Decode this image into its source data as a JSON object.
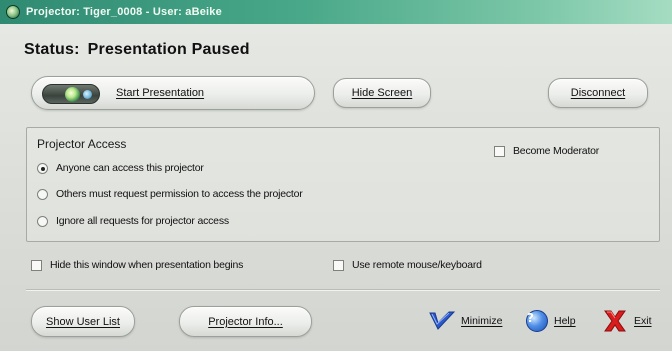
{
  "window": {
    "title": "Projector: Tiger_0008 - User: aBeike",
    "app_icon": "projector-app-icon"
  },
  "status": {
    "label": "Status:",
    "value": "Presentation Paused"
  },
  "top_buttons": {
    "start_presentation": "Start Presentation",
    "hide_screen": "Hide Screen",
    "disconnect": "Disconnect"
  },
  "access": {
    "legend": "Projector Access",
    "options": [
      {
        "label": "Anyone can access this projector",
        "checked": true
      },
      {
        "label": "Others must request permission to access the projector",
        "checked": false
      },
      {
        "label": "Ignore all requests for projector access",
        "checked": false
      }
    ],
    "become_moderator": {
      "label": "Become Moderator",
      "checked": false
    }
  },
  "options": {
    "hide_window": {
      "label": "Hide this window when presentation begins",
      "checked": false
    },
    "remote_input": {
      "label": "Use remote mouse/keyboard",
      "checked": false
    }
  },
  "bottom": {
    "show_user_list": "Show User List",
    "projector_info": "Projector Info...",
    "minimize": "Minimize",
    "help": "Help",
    "exit": "Exit"
  },
  "colors": {
    "titlebar_start": "#2f8a72",
    "titlebar_end": "#a5dcc2",
    "background": "#d9dbd8",
    "minimize_icon": "#2c58c9",
    "help_icon": "#2d66d1",
    "exit_icon": "#d91c1c"
  }
}
